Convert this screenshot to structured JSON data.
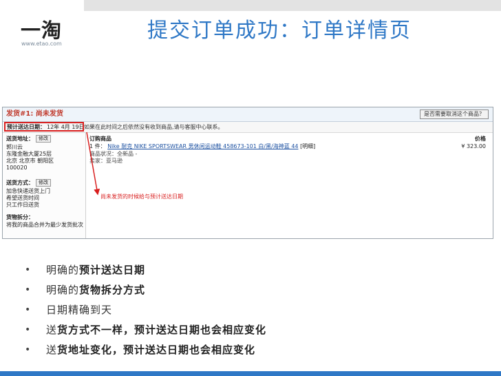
{
  "logo": {
    "main": "一淘",
    "url": "www.etao.com"
  },
  "title": {
    "prefix": "提交",
    "rest": "订单成功：订单详情页"
  },
  "screenshot": {
    "header_title": "发货#1: 尚未发货",
    "header_button": "是否需要取消这个商品？",
    "delivery_label": "预计送达日期：",
    "delivery_date": "12年 4月 19日",
    "delivery_note": "如果在此时间之后依然没有收到商品,请与客服中心联系。",
    "address_title": "送货地址：",
    "edit_label": "修改",
    "address_lines": [
      "郭川云",
      "东隆金融大厦25层",
      "北京 北京市 朝阳区",
      "100020"
    ],
    "ship_title": "送货方式：",
    "ship_lines": [
      "加急快递送货上门",
      "希望送货时间",
      "只工作日送货"
    ],
    "split_title": "货物拆分：",
    "split_lines": [
      "将我的商品合并为最少发货批次"
    ],
    "items_label": "订购商品",
    "price_label": "价格",
    "item_prefix": "1 件：",
    "item_link": "Nike 耐克 NIKE SPORTSWEAR 男休闲运动鞋 458673-101 白/黑/海神蓝 44",
    "item_tag": "[明细]",
    "item_price": "¥ 323.00",
    "item_status": "商品状况：全新品 -",
    "item_seller": "卖家：亚马逊",
    "annotation": "尚未发货的时候给与预计送达日期"
  },
  "bullets": [
    {
      "plain": "明确的",
      "bold": "预计送达日期"
    },
    {
      "plain": "明确的",
      "bold": "货物拆分方式"
    },
    {
      "plain": "日期精确到天",
      "bold": ""
    },
    {
      "plain": "送",
      "bold": "货方式不一样，预计送达日期也会相应变化"
    },
    {
      "plain": "送",
      "bold": "货地址变化，预计送达日期也会相应变化"
    }
  ],
  "bullet_symbol": "•",
  "colors": {
    "accent": "#2f78c6",
    "highlight_red": "#d81e1e"
  }
}
